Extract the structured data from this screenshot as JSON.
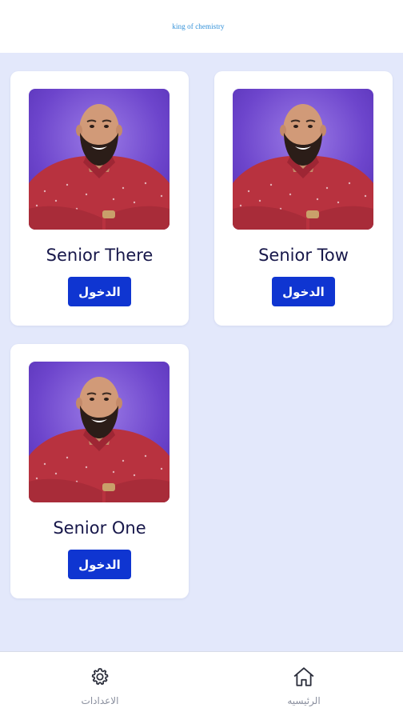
{
  "header": {
    "title": "king of chemistry"
  },
  "cards": [
    {
      "title": "Senior There",
      "button_label": "الدخول"
    },
    {
      "title": "Senior Tow",
      "button_label": "الدخول"
    },
    {
      "title": "Senior One",
      "button_label": "الدخول"
    }
  ],
  "bottom_nav": {
    "settings": {
      "label": "الاعدادات",
      "icon": "gear-icon"
    },
    "home": {
      "label": "الرئيسيه",
      "icon": "home-icon"
    }
  },
  "colors": {
    "background": "#e3e8fb",
    "button": "#0f35d1",
    "title": "#17174a",
    "photo_background": "#6a3fc8",
    "shirt": "#b8323f"
  }
}
